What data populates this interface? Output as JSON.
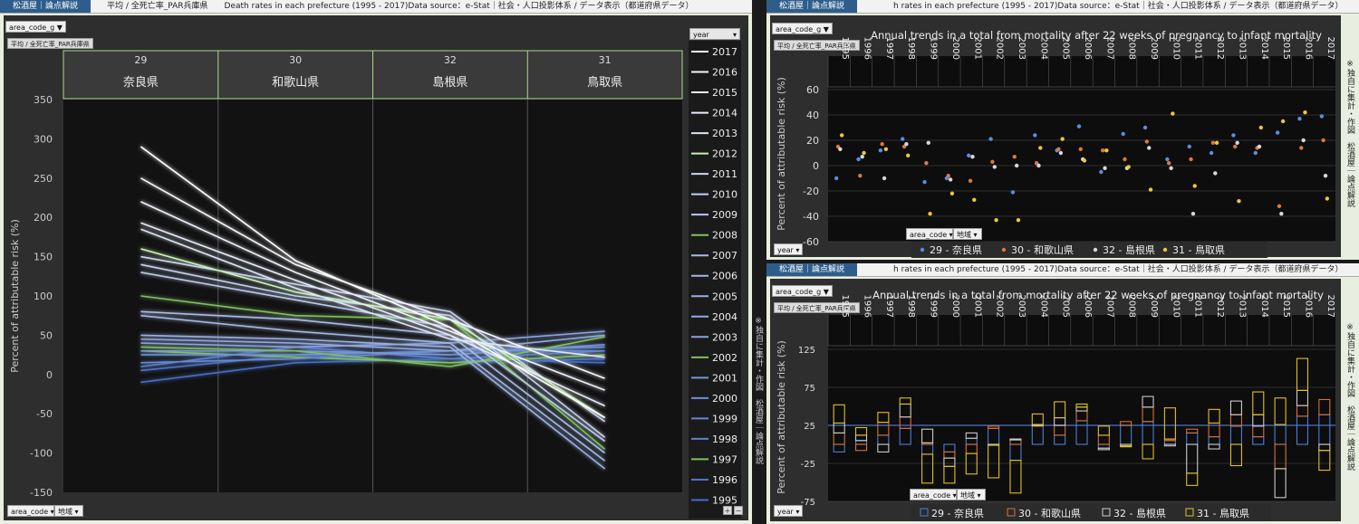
{
  "left": {
    "header": {
      "brand": "松酒屋｜論点解説",
      "subtitle": "平均 / 全死亡率_PAR兵庫県",
      "title": "Death rates in each prefecture (1995 - 2017)Data source：e-Stat｜社会・人口投影体系 / データ表示（都道府県データ）"
    },
    "filter_area": "area_code_g",
    "pill": "平均 / 全死亡率_PAR兵庫県",
    "year_filter": "year",
    "columns": [
      {
        "code": "29",
        "name": "奈良県"
      },
      {
        "code": "30",
        "name": "和歌山県"
      },
      {
        "code": "32",
        "name": "島根県"
      },
      {
        "code": "31",
        "name": "鳥取県"
      }
    ],
    "ylabel": "Percent of attributable risk (%)",
    "yticks": [
      "350",
      "300",
      "250",
      "200",
      "150",
      "100",
      "50",
      "0",
      "-50",
      "-100",
      "-150"
    ],
    "years": [
      "2017",
      "2016",
      "2015",
      "2014",
      "2013",
      "2012",
      "2011",
      "2010",
      "2009",
      "2008",
      "2007",
      "2006",
      "2005",
      "2004",
      "2003",
      "2002",
      "2001",
      "2000",
      "1999",
      "1998",
      "1997",
      "1996",
      "1995"
    ],
    "footer_dd1": "area_code",
    "footer_dd2": "地域",
    "zoom_plus": "+",
    "zoom_minus": "−",
    "chart_data": {
      "type": "line",
      "categories": [
        "奈良県",
        "和歌山県",
        "島根県",
        "鳥取県"
      ],
      "ylabel": "Percent of attributable risk (%)",
      "ylim": [
        -150,
        350
      ],
      "series": [
        {
          "name": "2017",
          "values": [
            290,
            145,
            60,
            -55
          ]
        },
        {
          "name": "2016",
          "values": [
            250,
            140,
            70,
            -5
          ]
        },
        {
          "name": "2015",
          "values": [
            220,
            130,
            55,
            -20
          ]
        },
        {
          "name": "2014",
          "values": [
            193,
            120,
            50,
            -40
          ]
        },
        {
          "name": "2013",
          "values": [
            185,
            110,
            45,
            22
          ]
        },
        {
          "name": "2012",
          "values": [
            160,
            105,
            70,
            -55
          ]
        },
        {
          "name": "2011",
          "values": [
            150,
            115,
            80,
            -60
          ]
        },
        {
          "name": "2010",
          "values": [
            140,
            100,
            75,
            -80
          ]
        },
        {
          "name": "2009",
          "values": [
            130,
            95,
            60,
            -85
          ]
        },
        {
          "name": "2008",
          "values": [
            100,
            75,
            70,
            -95
          ]
        },
        {
          "name": "2007",
          "values": [
            80,
            70,
            50,
            -100
          ]
        },
        {
          "name": "2006",
          "values": [
            75,
            55,
            40,
            -110
          ]
        },
        {
          "name": "2005",
          "values": [
            50,
            45,
            35,
            -120
          ]
        },
        {
          "name": "2004",
          "values": [
            45,
            40,
            30,
            50
          ]
        },
        {
          "name": "2003",
          "values": [
            40,
            35,
            40,
            55
          ]
        },
        {
          "name": "2002",
          "values": [
            35,
            30,
            10,
            48
          ]
        },
        {
          "name": "2001",
          "values": [
            30,
            30,
            25,
            38
          ]
        },
        {
          "name": "2000",
          "values": [
            25,
            25,
            30,
            35
          ]
        },
        {
          "name": "1999",
          "values": [
            15,
            20,
            30,
            30
          ]
        },
        {
          "name": "1998",
          "values": [
            10,
            35,
            20,
            30
          ]
        },
        {
          "name": "1997",
          "values": [
            30,
            22,
            15,
            25
          ]
        },
        {
          "name": "1996",
          "values": [
            5,
            25,
            15,
            20
          ]
        },
        {
          "name": "1995",
          "values": [
            -10,
            15,
            20,
            15
          ]
        }
      ]
    }
  },
  "top_right": {
    "header": {
      "brand": "松酒屋｜論点解説",
      "title": "h rates in each prefecture (1995 - 2017)Data source：e-Stat｜社会・人口投影体系 / データ表示（都道府県データ）"
    },
    "filter_area": "area_code_g",
    "pill": "平均 / 全死亡率_PAR兵庫県",
    "title": "Annual trends in a total from mortality after 22 weeks of pregnancy to infant mortality",
    "ylabel": "Percent of attributable risk (%)",
    "yticks": [
      "60",
      "40",
      "20",
      "0",
      "-20",
      "-40",
      "-60"
    ],
    "side_note": "※独自に集計・作図　松酒屋｜論点解説",
    "year_dd": "year",
    "area_dd1": "area_code",
    "area_dd2": "地域",
    "legend": [
      "29 - 奈良県",
      "30 - 和歌山県",
      "32 - 島根県",
      "31 - 鳥取県"
    ],
    "colors": [
      "#5b8de0",
      "#e0763a",
      "#d8d8d8",
      "#e8c93a"
    ],
    "chart_data": {
      "type": "scatter",
      "title": "Annual trends in a total from mortality after 22 weeks of pregnancy to infant mortality",
      "ylabel": "Percent of attributable risk (%)",
      "ylim": [
        -60,
        60
      ],
      "x": [
        "1995",
        "1996",
        "1997",
        "1998",
        "1999",
        "2000",
        "2001",
        "2002",
        "2003",
        "2004",
        "2005",
        "2006",
        "2007",
        "2008",
        "2009",
        "2010",
        "2011",
        "2012",
        "2013",
        "2014",
        "2015",
        "2016",
        "2017"
      ],
      "series": [
        {
          "name": "29 - 奈良県",
          "values": [
            -10,
            5,
            12,
            21,
            -13,
            -10,
            8,
            21,
            -21,
            24,
            12,
            31,
            -5,
            25,
            30,
            5,
            15,
            10,
            24,
            10,
            26,
            37,
            39
          ]
        },
        {
          "name": "30 - 和歌山県",
          "values": [
            15,
            -8,
            17,
            15,
            2,
            -8,
            -12,
            3,
            7,
            2,
            13,
            13,
            12,
            5,
            19,
            2,
            5,
            18,
            15,
            14,
            -32,
            14,
            20
          ]
        },
        {
          "name": "32 - 島根県",
          "values": [
            13,
            7,
            -10,
            17,
            18,
            -11,
            7,
            -1,
            0,
            0,
            10,
            5,
            -2,
            -2,
            14,
            -2,
            -38,
            -6,
            18,
            15,
            -38,
            20,
            -8
          ]
        },
        {
          "name": "31 - 鳥取県",
          "values": [
            24,
            10,
            13,
            8,
            -38,
            -22,
            -27,
            -43,
            -43,
            14,
            21,
            4,
            12,
            -1,
            -19,
            41,
            -16,
            18,
            -28,
            30,
            35,
            42,
            -26
          ]
        }
      ]
    }
  },
  "bottom_right": {
    "header": {
      "brand": "松酒屋｜論点解説",
      "title": "h rates in each prefecture (1995 - 2017)Data source：e-Stat｜社会・人口投影体系 / データ表示（都道府県データ）"
    },
    "filter_area": "area_code_g",
    "pill": "平均 / 全死亡率_PAR兵庫県",
    "title": "Annual trends in a total from mortality after 22 weeks of pregnancy to infant mortality",
    "ylabel": "Percent of attributable risk (%)",
    "yticks": [
      "125",
      "75",
      "25",
      "-25",
      "-75"
    ],
    "side_note": "※独自に集計・作図　松酒屋｜論点解説",
    "year_dd": "year",
    "area_dd1": "area_code",
    "area_dd2": "地域",
    "legend": [
      "29 - 奈良県",
      "30 - 和歌山県",
      "32 - 島根県",
      "31 - 鳥取県"
    ],
    "colors": [
      "#4a7fd8",
      "#d8703a",
      "#cccccc",
      "#e0c020"
    ],
    "chart_data": {
      "type": "bar",
      "title": "Annual trends in a total from mortality after 22 weeks of pregnancy to infant mortality",
      "ylabel": "Percent of attributable risk (%)",
      "ylim": [
        -75,
        125
      ],
      "stacked": true,
      "categories": [
        "1995",
        "1996",
        "1997",
        "1998",
        "1999",
        "2000",
        "2001",
        "2002",
        "2003",
        "2004",
        "2005",
        "2006",
        "2007",
        "2008",
        "2009",
        "2010",
        "2011",
        "2012",
        "2013",
        "2014",
        "2015",
        "2016",
        "2017"
      ],
      "series": [
        {
          "name": "29 - 奈良県",
          "values": [
            -10,
            5,
            12,
            21,
            -13,
            -10,
            8,
            21,
            -21,
            24,
            12,
            31,
            -5,
            25,
            30,
            5,
            15,
            10,
            24,
            10,
            26,
            37,
            39
          ]
        },
        {
          "name": "30 - 和歌山県",
          "values": [
            15,
            -8,
            17,
            15,
            2,
            -8,
            -12,
            3,
            7,
            2,
            13,
            13,
            12,
            5,
            19,
            2,
            5,
            18,
            15,
            14,
            -32,
            14,
            20
          ]
        },
        {
          "name": "32 - 島根県",
          "values": [
            13,
            7,
            -10,
            17,
            18,
            -11,
            7,
            -1,
            0,
            0,
            10,
            5,
            -2,
            -2,
            14,
            -2,
            -38,
            -6,
            18,
            15,
            -38,
            20,
            -8
          ]
        },
        {
          "name": "31 - 鳥取県",
          "values": [
            24,
            10,
            13,
            8,
            -38,
            -22,
            -27,
            -43,
            -43,
            14,
            21,
            4,
            12,
            -1,
            -19,
            41,
            -16,
            18,
            -28,
            30,
            35,
            42,
            -26
          ]
        }
      ]
    }
  }
}
